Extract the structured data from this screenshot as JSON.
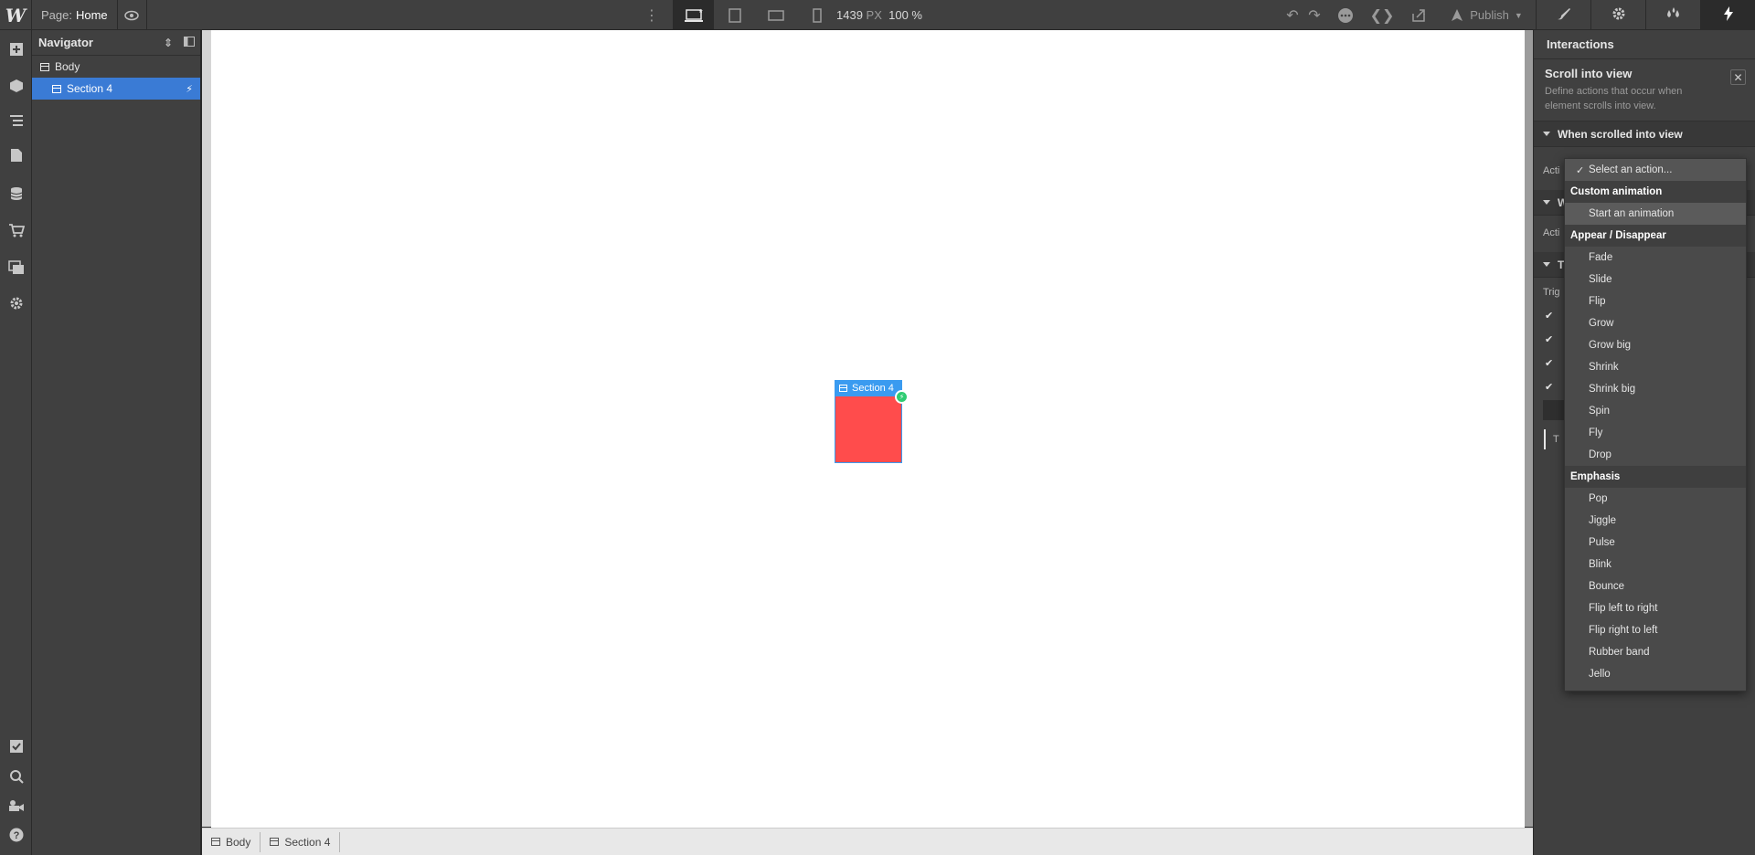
{
  "topbar": {
    "logo": "W",
    "page_label": "Page:",
    "page_name": "Home",
    "width_value": "1439",
    "width_unit": "PX",
    "zoom": "100 %",
    "publish_label": "Publish"
  },
  "navigator": {
    "title": "Navigator",
    "items": [
      {
        "label": "Body"
      },
      {
        "label": "Section 4"
      }
    ]
  },
  "canvas": {
    "section_label": "Section 4",
    "section_color": "#ff4c4c",
    "selection_color": "#3a9bf0"
  },
  "breadcrumb": [
    "Body",
    "Section 4"
  ],
  "right_panel": {
    "title": "Interactions",
    "trigger_title": "Scroll into view",
    "trigger_desc": "Define actions that occur when element scrolls into view.",
    "section_when": "When scrolled into view",
    "action_label_prefix": "Acti",
    "section2_prefix": "W",
    "action2_label_prefix": "Acti",
    "section3_prefix": "T",
    "trigger_label_prefix": "Trig",
    "row_prefix": "T"
  },
  "dropdown": {
    "selected": "Select an action...",
    "groups": [
      {
        "header": "Custom animation",
        "items": [
          "Start an animation"
        ]
      },
      {
        "header": "Appear / Disappear",
        "items": [
          "Fade",
          "Slide",
          "Flip",
          "Grow",
          "Grow big",
          "Shrink",
          "Shrink big",
          "Spin",
          "Fly",
          "Drop"
        ]
      },
      {
        "header": "Emphasis",
        "items": [
          "Pop",
          "Jiggle",
          "Pulse",
          "Blink",
          "Bounce",
          "Flip left to right",
          "Flip right to left",
          "Rubber band",
          "Jello"
        ]
      }
    ]
  },
  "colors": {
    "accent": "#3a7bd5",
    "badge": "#2ecc71"
  }
}
